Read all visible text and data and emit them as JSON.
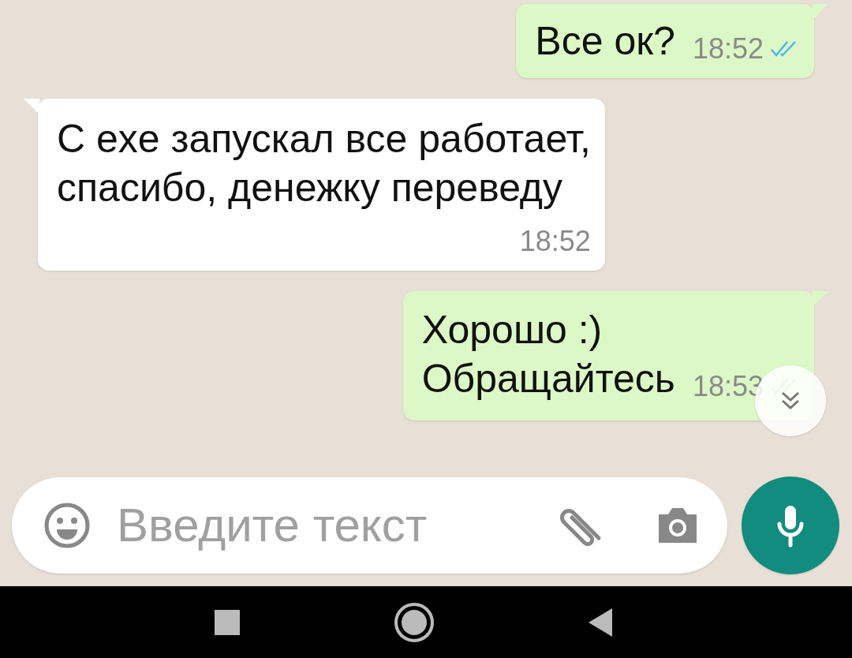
{
  "messages": [
    {
      "kind": "outgoing",
      "text": "Все ок?",
      "time": "18:52",
      "read": true
    },
    {
      "kind": "incoming",
      "text": "С exe запускал все работает,\nспасибо, денежку переведу",
      "time": "18:52"
    },
    {
      "kind": "outgoing",
      "text": "Хорошо :)\nОбращайтесь",
      "time": "18:53",
      "read": false
    }
  ],
  "composer": {
    "placeholder": "Введите текст"
  }
}
